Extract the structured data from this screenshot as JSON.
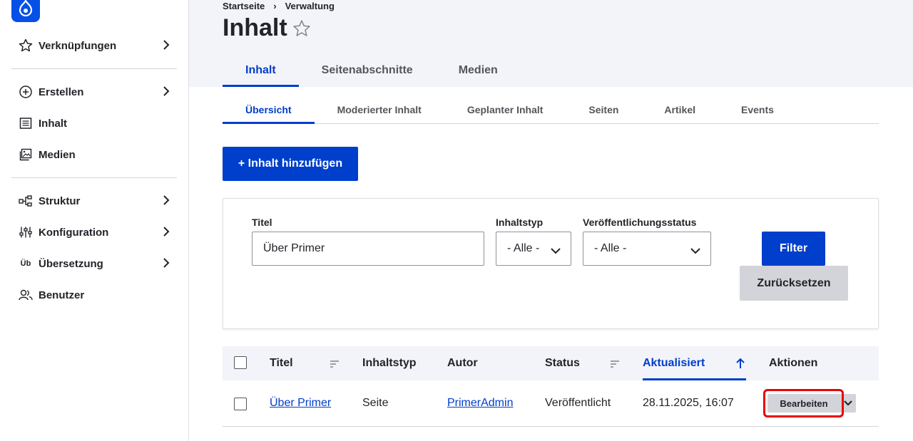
{
  "breadcrumb": {
    "home": "Startseite",
    "separator": "›",
    "admin": "Verwaltung"
  },
  "page": {
    "title": "Inhalt",
    "favorite_icon": "star-outline-icon"
  },
  "sidebar": {
    "items": [
      {
        "label": "Verknüpfungen",
        "icon": "star-icon",
        "has_children": true
      },
      {
        "label": "Erstellen",
        "icon": "plus-circle-icon",
        "has_children": true
      },
      {
        "label": "Inhalt",
        "icon": "document-list-icon",
        "has_children": false
      },
      {
        "label": "Medien",
        "icon": "image-icon",
        "has_children": false
      },
      {
        "label": "Struktur",
        "icon": "structure-icon",
        "has_children": true
      },
      {
        "label": "Konfiguration",
        "icon": "sliders-icon",
        "has_children": true
      },
      {
        "label": "Übersetzung",
        "icon_text": "Üb",
        "has_children": true
      },
      {
        "label": "Benutzer",
        "icon": "users-icon",
        "has_children": false
      }
    ]
  },
  "primary_tabs": [
    {
      "label": "Inhalt",
      "active": true
    },
    {
      "label": "Seitenabschnitte",
      "active": false
    },
    {
      "label": "Medien",
      "active": false
    }
  ],
  "secondary_tabs": [
    {
      "label": "Übersicht",
      "active": true
    },
    {
      "label": "Moderierter Inhalt",
      "active": false
    },
    {
      "label": "Geplanter Inhalt",
      "active": false
    },
    {
      "label": "Seiten",
      "active": false
    },
    {
      "label": "Artikel",
      "active": false
    },
    {
      "label": "Events",
      "active": false
    }
  ],
  "add_button": "+ Inhalt hinzufügen",
  "filter": {
    "title_label": "Titel",
    "title_value": "Über Primer",
    "type_label": "Inhaltstyp",
    "type_value": "- Alle -",
    "status_label": "Veröffentlichungsstatus",
    "status_value": "- Alle -",
    "filter_button": "Filter",
    "reset_button": "Zurücksetzen"
  },
  "table": {
    "headers": {
      "title": "Titel",
      "type": "Inhaltstyp",
      "author": "Autor",
      "status": "Status",
      "updated": "Aktualisiert",
      "actions": "Aktionen"
    },
    "rows": [
      {
        "title": "Über Primer",
        "type": "Seite",
        "author": "PrimerAdmin",
        "status": "Veröffentlicht",
        "updated": "28.11.2025, 16:07",
        "edit": "Bearbeiten"
      }
    ]
  },
  "colors": {
    "accent": "#003ecc",
    "header_bg": "#f3f4f9",
    "highlight": "#e8000b"
  }
}
